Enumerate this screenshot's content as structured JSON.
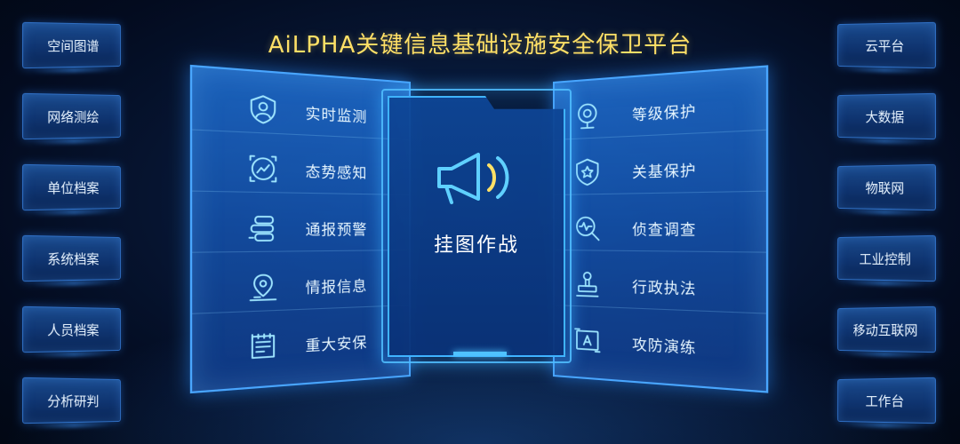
{
  "title": "AiLPHA关键信息基础设施安全保卫平台",
  "left_buttons": [
    "空间图谱",
    "网络测绘",
    "单位档案",
    "系统档案",
    "人员档案",
    "分析研判"
  ],
  "right_buttons": [
    "云平台",
    "大数据",
    "物联网",
    "工业控制",
    "移动互联网",
    "工作台"
  ],
  "left_panel": [
    {
      "label": "实时监测",
      "icon": "shield-user-icon"
    },
    {
      "label": "态势感知",
      "icon": "trend-target-icon"
    },
    {
      "label": "通报预警",
      "icon": "notify-icon"
    },
    {
      "label": "情报信息",
      "icon": "location-pin-icon"
    },
    {
      "label": "重大安保",
      "icon": "document-list-icon"
    }
  ],
  "right_panel": [
    {
      "label": "等级保护",
      "icon": "webcam-icon"
    },
    {
      "label": "关基保护",
      "icon": "star-shield-icon"
    },
    {
      "label": "侦查调查",
      "icon": "magnifier-pulse-icon"
    },
    {
      "label": "行政执法",
      "icon": "stamp-icon"
    },
    {
      "label": "攻防演练",
      "icon": "image-swap-icon"
    }
  ],
  "center": {
    "label": "挂图作战",
    "icon": "megaphone-icon"
  },
  "colors": {
    "title": "#ffe066",
    "accent": "#49a6ff",
    "icon": "#9fe6ff"
  }
}
